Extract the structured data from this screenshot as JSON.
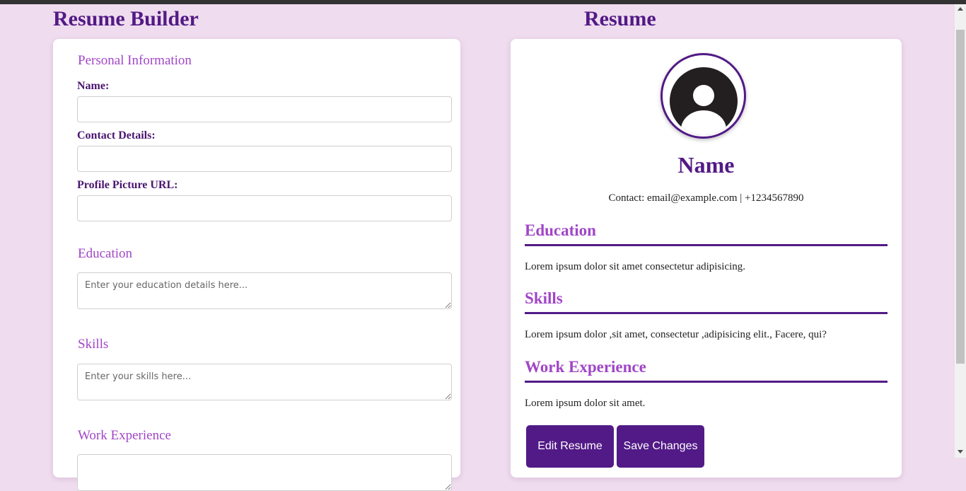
{
  "builder": {
    "title": "Resume Builder",
    "personal_heading": "Personal Information",
    "name_label": "Name:",
    "name_value": "",
    "contact_label": "Contact Details:",
    "contact_value": "",
    "picture_label": "Profile Picture URL:",
    "picture_value": "",
    "education_heading": "Education",
    "education_placeholder": "Enter your education details here...",
    "skills_heading": "Skills",
    "skills_placeholder": "Enter your skills here...",
    "work_heading": "Work Experience"
  },
  "resume": {
    "title": "Resume",
    "name": "Name",
    "contact": "Contact: email@example.com | +1234567890",
    "education_heading": "Education",
    "education_text": "Lorem ipsum dolor sit amet consectetur adipisicing.",
    "skills_heading": "Skills",
    "skills_text": "Lorem ipsum dolor ,sit amet, consectetur ,adipisicing elit., Facere, qui?",
    "work_heading": "Work Experience",
    "work_text": "Lorem ipsum dolor sit amet.",
    "edit_button": "Edit Resume",
    "save_button": "Save Changes",
    "avatar_icon": "user-avatar-icon"
  },
  "colors": {
    "background": "#efdcee",
    "primary": "#521a86",
    "accent": "#a146c7"
  }
}
